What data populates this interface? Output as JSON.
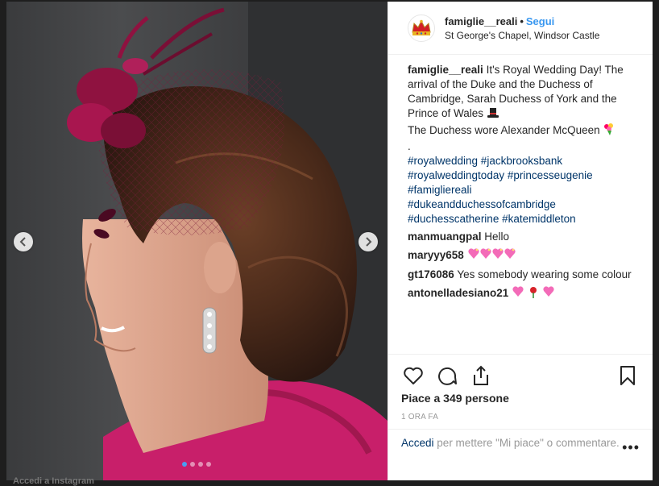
{
  "header": {
    "username": "famiglie__reali",
    "separator": "•",
    "follow_label": "Segui",
    "location": "St George's Chapel, Windsor Castle"
  },
  "caption": {
    "username": "famiglie__reali",
    "line1": "It's Royal Wedding Day! The arrival of the Duke and the Duchess of Cambridge, Sarah Duchess of York and the Prince of Wales",
    "line2": "The Duchess wore Alexander McQueen",
    "dot": ".",
    "hashtags": [
      "#royalwedding #jackbrooksbank",
      "#royalweddingtoday #princesseugenie",
      "#famigliereali",
      "#dukeandduchessofcambridge",
      "#duchesscatherine #katemiddleton"
    ]
  },
  "comments": [
    {
      "username": "manmuangpal",
      "text": "Hello"
    },
    {
      "username": "maryyy658",
      "text": ""
    },
    {
      "username": "gt176086",
      "text": "Yes somebody wearing some colour"
    },
    {
      "username": "antonelladesiano21",
      "text": ""
    }
  ],
  "likes": "Piace a 349 persone",
  "timestamp": "1 ORA FA",
  "login": {
    "link": "Accedi",
    "text": "per mettere \"Mi piace\" o commentare."
  },
  "more_label": "•••",
  "footer_peek": "Accedi a Instagram",
  "icons": {
    "avatar": "crown-icon",
    "like": "heart-outline-icon",
    "comment": "speech-bubble-icon",
    "share": "share-icon",
    "save": "bookmark-icon",
    "prev": "chevron-left-icon",
    "next": "chevron-right-icon"
  },
  "carousel": {
    "count": 4,
    "active": 1
  },
  "colors": {
    "link": "#003569",
    "follow": "#3897f0",
    "muted": "#999999",
    "active_dot": "#4a9df2"
  }
}
